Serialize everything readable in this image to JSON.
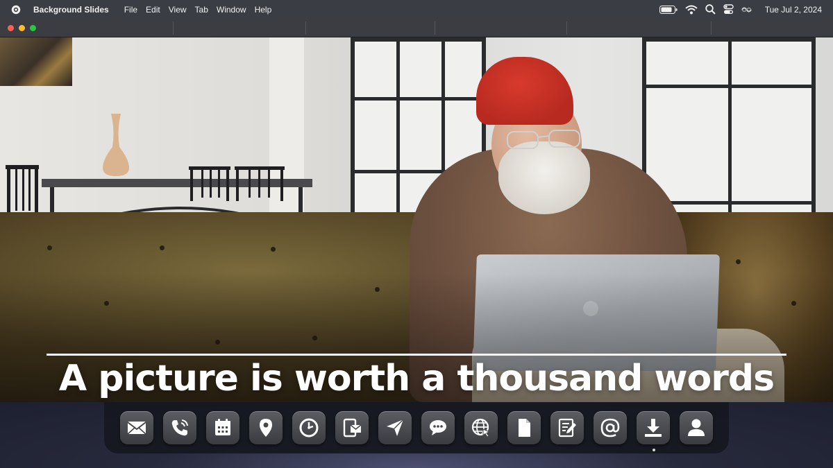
{
  "menubar": {
    "app_name": "Background Slides",
    "menus": [
      "File",
      "Edit",
      "View",
      "Tab",
      "Window",
      "Help"
    ],
    "clock": "Tue  Jul 2, 2024",
    "status_icons": [
      "battery-icon",
      "wifi-icon",
      "search-icon",
      "control-center-icon",
      "siri-icon"
    ]
  },
  "slide": {
    "caption": "A picture is worth a thousand words"
  },
  "dock": {
    "items": [
      {
        "name": "mail-app",
        "icon": "envelope-icon"
      },
      {
        "name": "phone-app",
        "icon": "phone-icon"
      },
      {
        "name": "calendar-app",
        "icon": "calendar-icon"
      },
      {
        "name": "maps-app",
        "icon": "location-pin-icon"
      },
      {
        "name": "clock-app",
        "icon": "clock-icon"
      },
      {
        "name": "tablet-mail-app",
        "icon": "tablet-mail-icon"
      },
      {
        "name": "send-app",
        "icon": "paper-plane-icon"
      },
      {
        "name": "messages-app",
        "icon": "chat-bubble-icon"
      },
      {
        "name": "browser-app",
        "icon": "globe-cursor-icon"
      },
      {
        "name": "files-app",
        "icon": "document-icon"
      },
      {
        "name": "notes-app",
        "icon": "notepad-edit-icon"
      },
      {
        "name": "contacts-email-app",
        "icon": "at-sign-icon"
      },
      {
        "name": "downloads-app",
        "icon": "download-icon"
      },
      {
        "name": "user-app",
        "icon": "user-icon"
      }
    ],
    "running_indicator": "downloads-app"
  },
  "colors": {
    "menubar": "#3a3d44",
    "close": "#fe5f57",
    "minimize": "#febc2e",
    "zoom": "#28c840",
    "beanie": "#c8302a",
    "caption": "#ffffff"
  }
}
